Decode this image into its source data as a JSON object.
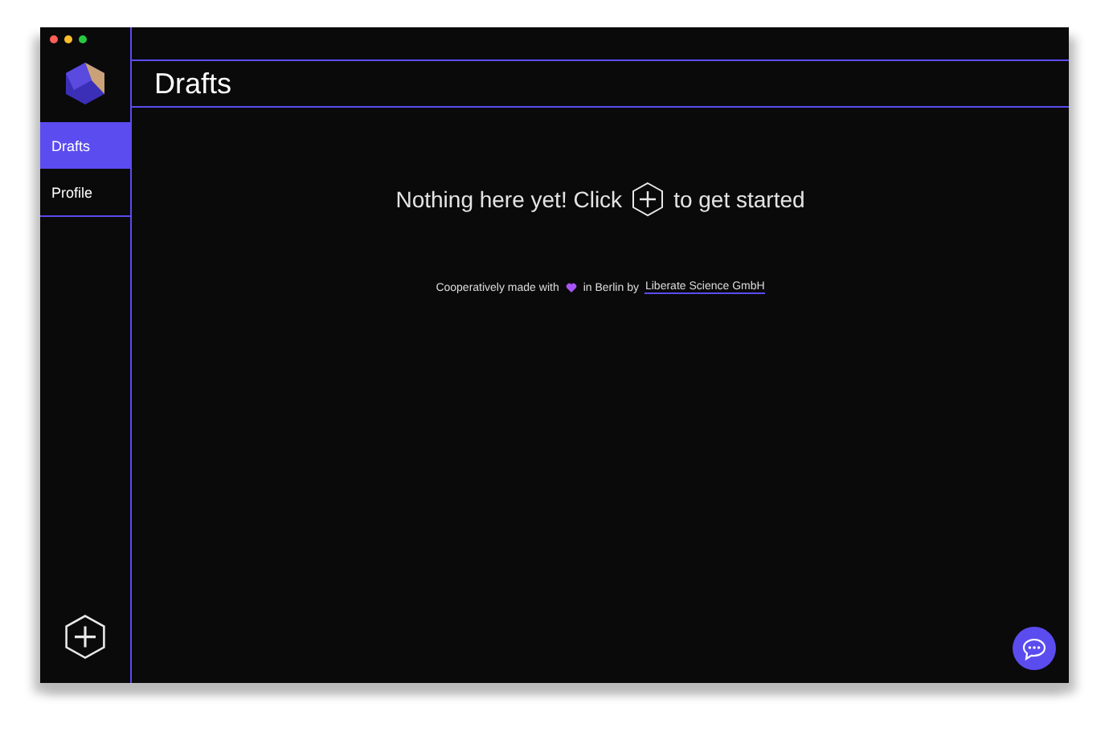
{
  "sidebar": {
    "items": [
      {
        "label": "Drafts",
        "selected": true
      },
      {
        "label": "Profile",
        "selected": false
      }
    ]
  },
  "page_title": "Drafts",
  "empty_state": {
    "before": "Nothing here yet! Click",
    "after": "to get started"
  },
  "footer": {
    "before": "Cooperatively made with",
    "after": "in Berlin by",
    "link": "Liberate Science GmbH"
  }
}
